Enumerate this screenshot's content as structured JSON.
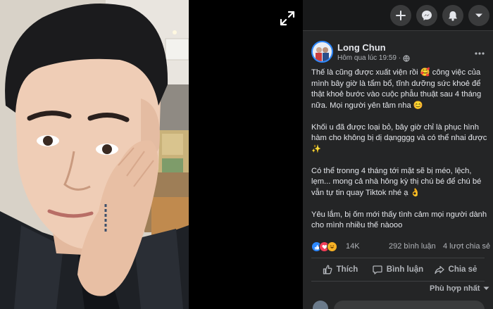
{
  "post": {
    "author": "Long Chun",
    "timestamp": "Hôm qua lúc 19:59 ·",
    "paragraphs": [
      "Thế là cũng được xuất viện rồi 🥰 công việc của mình bây giờ là tẩm bổ, tĩnh dưỡng sức khoẻ để thật khoẻ bước vào cuộc phẫu thuật sau 4 tháng nữa. Mọi người yên tâm nha 😊",
      "Khối u đã được loại bỏ, bây giờ chỉ là phục hình hàm cho không bị dị dạngggg và có thể nhai được ✨",
      "Có thể tronng 4 tháng tới mặt sẽ bị méo, lệch, lẹm... mong cả nhà hông kỳ thị chú bé để chú bé vẫn tự tin quay Tiktok nhé ạ 👌",
      "Yêu lắm, bị ốm mới thấy tình cảm mọi người dành cho mình nhiều thế nàooo"
    ]
  },
  "stats": {
    "reactions": "14K",
    "comments": "292 bình luận",
    "shares": "4 lượt chia sẻ"
  },
  "actions": {
    "like": "Thích",
    "comment": "Bình luận",
    "share": "Chia sẻ"
  },
  "sort": {
    "label": "Phù hợp nhất"
  },
  "icons": {
    "topbar": [
      "plus-icon",
      "messenger-icon",
      "notification-bell-icon",
      "account-menu-icon"
    ],
    "viewer": "expand-icon",
    "reactions": [
      "like-reaction-icon",
      "love-reaction-icon",
      "haha-reaction-icon"
    ]
  },
  "colors": {
    "panel_bg": "#242526",
    "topbar_bg": "#18191a",
    "text_primary": "#e4e6eb",
    "text_secondary": "#b0b3b8",
    "like_blue": "#2d88ff",
    "love_red": "#f33e58",
    "haha_yellow": "#f7b125"
  }
}
